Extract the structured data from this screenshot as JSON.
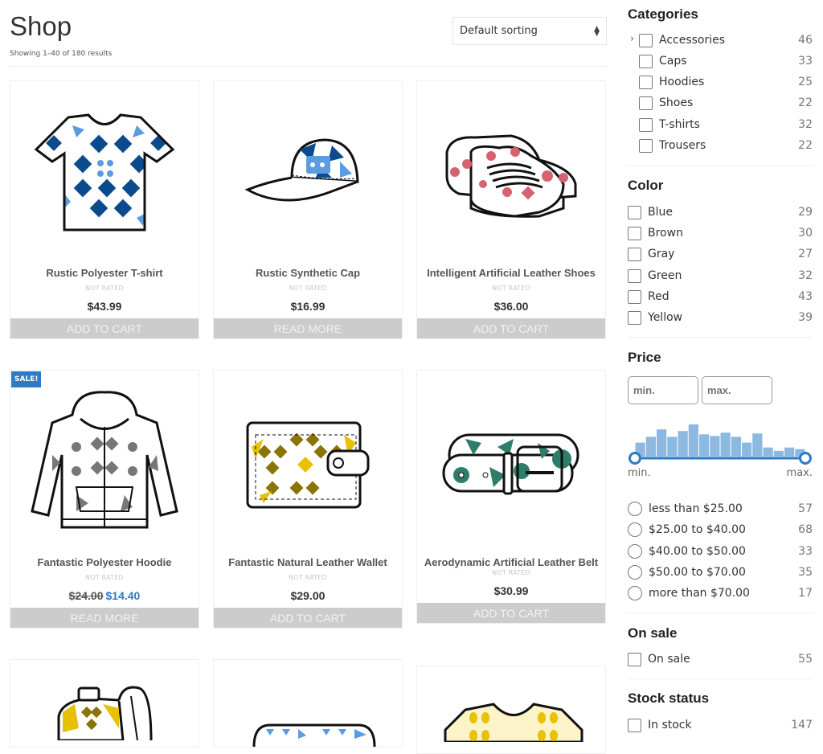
{
  "header": {
    "title": "Shop",
    "result_count": "Showing 1–40 of 180 results",
    "sorting": "Default sorting"
  },
  "products": [
    {
      "name": "Rustic Polyester T-shirt",
      "rating": "NOT RATED",
      "price": "$43.99",
      "button": "ADD TO CART",
      "icon": "tshirt-icon",
      "colors": [
        "#0b4a8c",
        "#5b9be0"
      ]
    },
    {
      "name": "Rustic Synthetic Cap",
      "rating": "NOT RATED",
      "price": "$16.99",
      "button": "READ MORE",
      "icon": "cap-icon",
      "colors": [
        "#0b4a8c",
        "#5b9be0"
      ]
    },
    {
      "name": "Intelligent Artificial Leather Shoes",
      "rating": "NOT RATED",
      "price": "$36.00",
      "button": "ADD TO CART",
      "icon": "shoes-icon",
      "colors": [
        "#d4636f"
      ]
    },
    {
      "name": "Fantastic Polyester Hoodie",
      "rating": "NOT RATED",
      "old_price": "$24.00",
      "price": "$14.40",
      "button": "READ MORE",
      "badge": "SALE!",
      "icon": "hoodie-icon",
      "colors": [
        "#777777"
      ]
    },
    {
      "name": "Fantastic Natural Leather Wallet",
      "rating": "NOT RATED",
      "price": "$29.00",
      "button": "ADD TO CART",
      "icon": "wallet-icon",
      "colors": [
        "#8a7406",
        "#e8c100"
      ]
    },
    {
      "name": "Aerodynamic Artificial Leather Belt",
      "rating": "NOT RATED",
      "price": "$30.99",
      "button": "ADD TO CART",
      "icon": "belt-icon",
      "colors": [
        "#2e7d6b"
      ]
    },
    {
      "icon": "backpack-icon",
      "colors": [
        "#8a7406",
        "#e8c100"
      ]
    },
    {
      "icon": "pencil-case-icon",
      "colors": [
        "#5b9be0"
      ]
    },
    {
      "icon": "sweater-icon",
      "colors": [
        "#e8c100",
        "#fcf3c8"
      ]
    }
  ],
  "sidebar": {
    "categories": {
      "title": "Categories",
      "items": [
        {
          "label": "Accessories",
          "count": "46",
          "expandable": true
        },
        {
          "label": "Caps",
          "count": "33"
        },
        {
          "label": "Hoodies",
          "count": "25"
        },
        {
          "label": "Shoes",
          "count": "22"
        },
        {
          "label": "T-shirts",
          "count": "32"
        },
        {
          "label": "Trousers",
          "count": "22"
        }
      ]
    },
    "color": {
      "title": "Color",
      "items": [
        {
          "label": "Blue",
          "count": "29"
        },
        {
          "label": "Brown",
          "count": "30"
        },
        {
          "label": "Gray",
          "count": "27"
        },
        {
          "label": "Green",
          "count": "32"
        },
        {
          "label": "Red",
          "count": "43"
        },
        {
          "label": "Yellow",
          "count": "39"
        }
      ]
    },
    "price": {
      "title": "Price",
      "min_placeholder": "min.",
      "max_placeholder": "max.",
      "min_label": "min.",
      "max_label": "max.",
      "histogram": [
        17,
        24,
        33,
        24,
        31,
        39,
        27,
        25,
        29,
        24,
        17,
        28,
        11,
        7,
        11,
        9
      ],
      "bar_color": "#8db8e0",
      "accent": "#2d7bc4",
      "ranges": [
        {
          "label": "less than $25.00",
          "count": "57"
        },
        {
          "label": "$25.00 to $40.00",
          "count": "68"
        },
        {
          "label": "$40.00 to $50.00",
          "count": "33"
        },
        {
          "label": "$50.00 to $70.00",
          "count": "35"
        },
        {
          "label": "more than $70.00",
          "count": "17"
        }
      ]
    },
    "on_sale": {
      "title": "On sale",
      "items": [
        {
          "label": "On sale",
          "count": "55"
        }
      ]
    },
    "stock": {
      "title": "Stock status",
      "items": [
        {
          "label": "In stock",
          "count": "147"
        }
      ]
    }
  }
}
